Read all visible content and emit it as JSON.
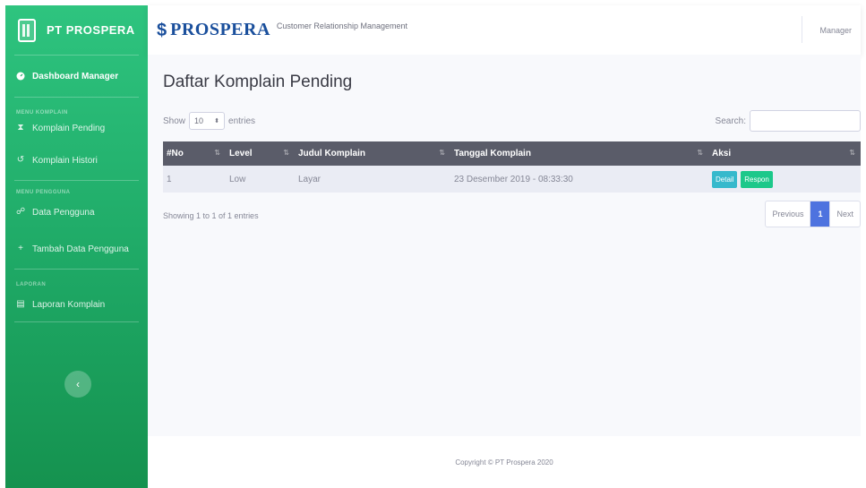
{
  "sidebar": {
    "brand": "PT PROSPERA",
    "dashboard": "Dashboard Manager",
    "sections": [
      {
        "heading": "MENU KOMPLAIN",
        "items": [
          "Komplain Pending",
          "Komplain Histori"
        ]
      },
      {
        "heading": "MENU PENGGUNA",
        "items": [
          "Data Pengguna",
          "Tambah Data Pengguna"
        ]
      },
      {
        "heading": "LAPORAN",
        "items": [
          "Laporan Komplain"
        ]
      }
    ],
    "toggle": "‹"
  },
  "topbar": {
    "logo_text": "PROSPERA",
    "subtitle": "Customer Relationship Management",
    "user": "Manager"
  },
  "main": {
    "title": "Daftar Komplain Pending",
    "length": {
      "show": "Show",
      "value": "10",
      "entries": "entries"
    },
    "search_label": "Search:",
    "table": {
      "columns": [
        "#No",
        "Level",
        "Judul Komplain",
        "Tanggal Komplain",
        "Aksi"
      ],
      "rows": [
        {
          "no": "1",
          "level": "Low",
          "judul": "Layar",
          "tanggal": "23 Desember 2019 - 08:33:30"
        }
      ],
      "actions": {
        "detail": "Detail",
        "respon": "Respon"
      }
    },
    "info": "Showing 1 to 1 of 1 entries",
    "pagination": {
      "previous": "Previous",
      "current": "1",
      "next": "Next"
    }
  },
  "footer": "Copyright © PT Prospera 2020",
  "colors": {
    "sidebar": "#1cc88a",
    "table_header": "#5a5c69",
    "detail_button": "#36b9cc",
    "respon_button": "#1cc88a",
    "active_page": "#4e73df",
    "logo": "#1a4f9c"
  }
}
